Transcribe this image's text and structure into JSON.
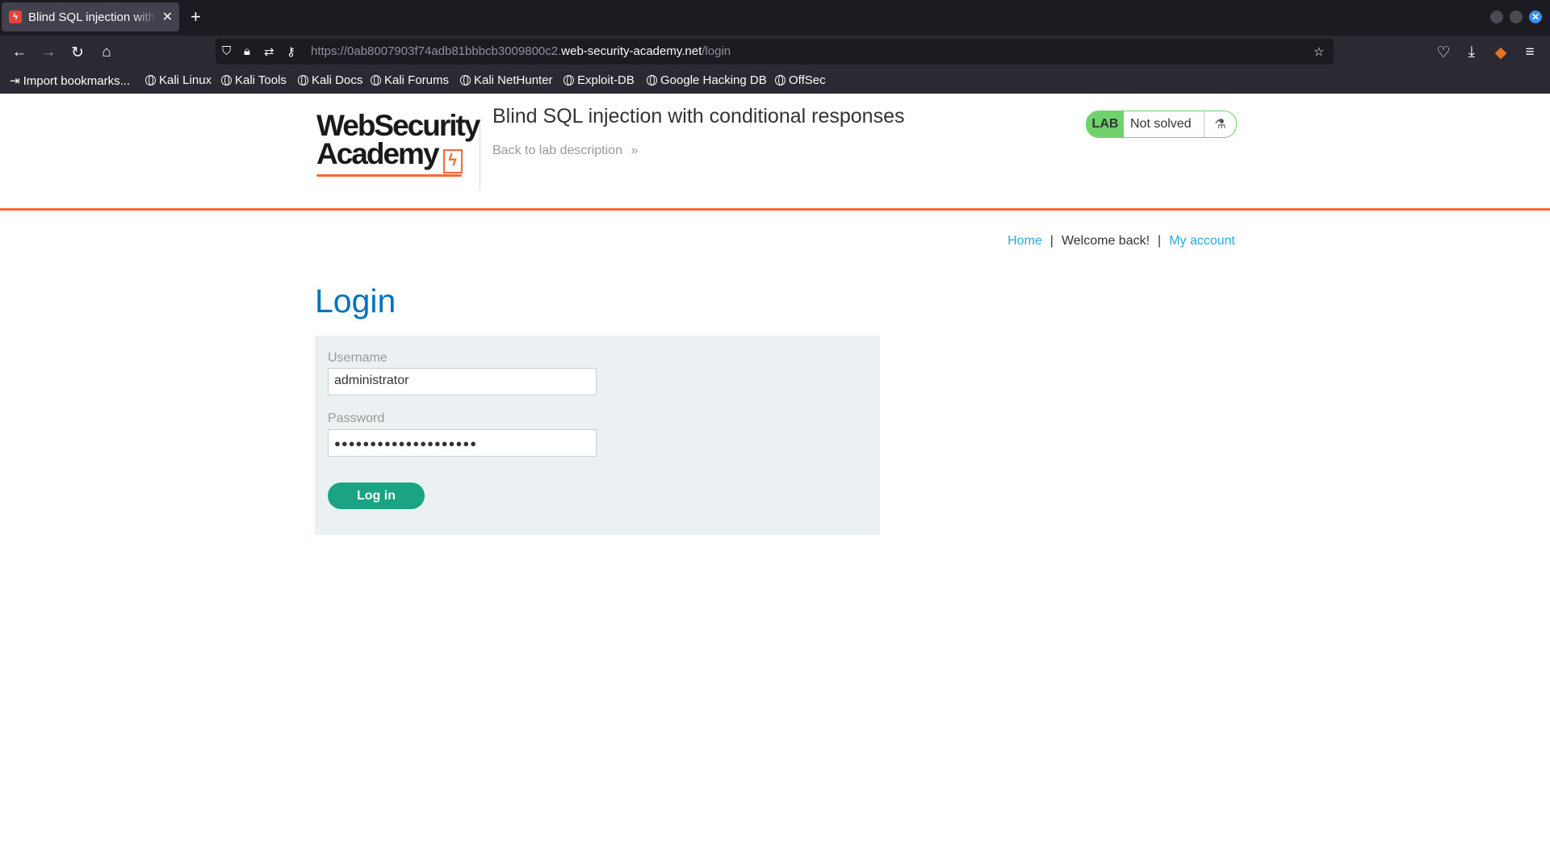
{
  "browser": {
    "tab_title": "Blind SQL injection with conditional responses",
    "tab_close": "✕",
    "new_tab": "+",
    "url_prefix": "https://0ab8007903f74adb81bbbcb3009800c2.",
    "url_host": "web-security-academy.net",
    "url_path": "/login",
    "bookmarks": [
      "Import bookmarks...",
      "Kali Linux",
      "Kali Tools",
      "Kali Docs",
      "Kali Forums",
      "Kali NetHunter",
      "Exploit-DB",
      "Google Hacking DB",
      "OffSec"
    ]
  },
  "lab": {
    "logo_line1": "WebSecurity",
    "logo_line2": "Academy",
    "title": "Blind SQL injection with conditional responses",
    "back_link": "Back to lab description",
    "back_chevron": "»",
    "status_tag": "LAB",
    "status": "Not solved",
    "accent_color": "#ff6633",
    "status_color": "#70d16d"
  },
  "nav": {
    "home": "Home",
    "sep": "|",
    "welcome": "Welcome back!",
    "my_account": "My account"
  },
  "page": {
    "title": "Login",
    "username_label": "Username",
    "username_value": "administrator",
    "password_label": "Password",
    "password_value": "●●●●●●●●●●●●●●●●●●●●",
    "login_button": "Log in",
    "title_color": "#0071bc",
    "button_color": "#1aa483"
  }
}
